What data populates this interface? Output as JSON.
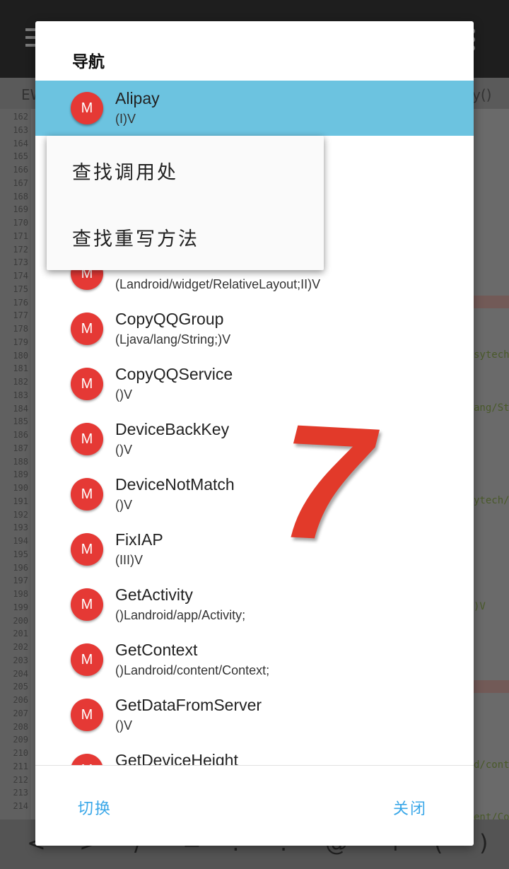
{
  "background": {
    "tab_left": "EW",
    "tab_right": "y()",
    "line_numbers": [
      "162",
      "163",
      "164",
      "165",
      "166",
      "167",
      "168",
      "169",
      "170",
      "171",
      "172",
      "173",
      "174",
      "175",
      "176",
      "177",
      "178",
      "179",
      "180",
      "181",
      "182",
      "183",
      "184",
      "185",
      "186",
      "187",
      "188",
      "189",
      "190",
      "191",
      "192",
      "193",
      "194",
      "195",
      "196",
      "197",
      "198",
      "199",
      "200",
      "201",
      "202",
      "203",
      "204",
      "205",
      "206",
      "207",
      "208",
      "209",
      "210",
      "211",
      "212",
      "213",
      "214"
    ],
    "code_fragments": [
      "sytech/",
      "ang/Str",
      "ytech/e",
      ")V",
      "d/cont",
      "ent/Con"
    ],
    "keys": [
      "<",
      ">",
      "/",
      "=",
      ":",
      ".",
      "@",
      "+",
      "(",
      ")"
    ]
  },
  "dialog": {
    "title": "导航",
    "items": [
      {
        "name": "Alipay",
        "signature": "(I)V",
        "icon": "M"
      },
      {
        "name": "",
        "signature": "",
        "icon": "M"
      },
      {
        "name": "",
        "signature": "",
        "icon": "M"
      },
      {
        "name": "",
        "signature": "(Landroid/widget/RelativeLayout;II)V",
        "icon": "M"
      },
      {
        "name": "CopyQQGroup",
        "signature": "(Ljava/lang/String;)V",
        "icon": "M"
      },
      {
        "name": "CopyQQService",
        "signature": "()V",
        "icon": "M"
      },
      {
        "name": "DeviceBackKey",
        "signature": "()V",
        "icon": "M"
      },
      {
        "name": "DeviceNotMatch",
        "signature": "()V",
        "icon": "M"
      },
      {
        "name": "FixIAP",
        "signature": "(III)V",
        "icon": "M"
      },
      {
        "name": "GetActivity",
        "signature": "()Landroid/app/Activity;",
        "icon": "M"
      },
      {
        "name": "GetContext",
        "signature": "()Landroid/content/Context;",
        "icon": "M"
      },
      {
        "name": "GetDataFromServer",
        "signature": "()V",
        "icon": "M"
      },
      {
        "name": "GetDeviceHeight",
        "signature": "",
        "icon": "M"
      }
    ],
    "button_switch": "切换",
    "button_close": "关闭"
  },
  "popup": {
    "find_callers": "查找调用处",
    "find_overrides": "查找重写方法"
  },
  "overlay_number": "7",
  "colors": {
    "selected_row": "#6cc3e0",
    "method_icon": "#e53935",
    "dialog_button": "#39a7e8"
  }
}
